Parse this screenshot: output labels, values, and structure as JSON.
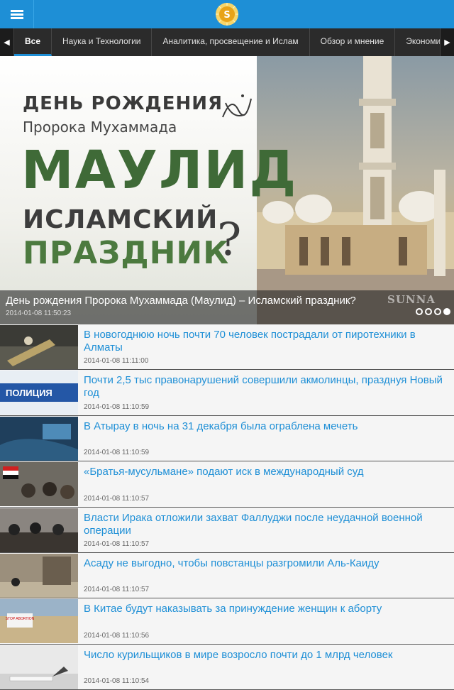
{
  "app": {
    "menu_icon": "hamburger-menu-icon",
    "logo_icon": "sunna-logo-icon",
    "accent": "#1e8fd6"
  },
  "tabs": {
    "prev_arrow": "◀",
    "next_arrow": "▶",
    "items": [
      {
        "label": "Все",
        "active": true
      },
      {
        "label": "Наука и Технологии"
      },
      {
        "label": "Аналитика, просвещение и Ислам"
      },
      {
        "label": "Обзор и мнение"
      },
      {
        "label": "Экономика"
      }
    ]
  },
  "featured": {
    "image": {
      "line1": "ДЕНЬ РОЖДЕНИЯ",
      "line2": "Пророка Мухаммада",
      "line3": "МАУЛИД",
      "line4": "ИСЛАМСКИЙ",
      "line5": "ПРАЗДНИК",
      "qmark": "?"
    },
    "title": "День рождения Пророка Мухаммада (Маулид) – Исламский праздник?",
    "time": "2014-01-08 11:50:23",
    "watermark": "SUNNA",
    "slides_total": 4,
    "slide_active": 4
  },
  "news": [
    {
      "title": "В новогоднюю ночь почти 70 человек пострадали от пиротехники в Алматы",
      "time": "2014-01-08 11:11:00"
    },
    {
      "title": "Почти 2,5 тыс правонарушений совершили акмолинцы, празднуя Новый год",
      "time": "2014-01-08 11:10:59",
      "thumb_text": "ПОЛИЦИЯ"
    },
    {
      "title": "В Атырау в ночь на 31 декабря была ограблена мечеть",
      "time": "2014-01-08 11:10:59"
    },
    {
      "title": "«Братья-мусульмане» подают иск в международный суд",
      "time": "2014-01-08 11:10:57"
    },
    {
      "title": "Власти Ирака отложили захват Фаллуджи после неудачной военной операции",
      "time": "2014-01-08 11:10:57"
    },
    {
      "title": "Асаду не выгодно, чтобы повстанцы разгромили Аль-Каиду",
      "time": "2014-01-08 11:10:57"
    },
    {
      "title": "В Китае будут наказывать за принуждение женщин к аборту",
      "time": "2014-01-08 11:10:56",
      "thumb_text": "STOP ABORTION"
    },
    {
      "title": "Число курильщиков в мире возросло почти до 1 млрд человек",
      "time": "2014-01-08 11:10:54"
    }
  ]
}
